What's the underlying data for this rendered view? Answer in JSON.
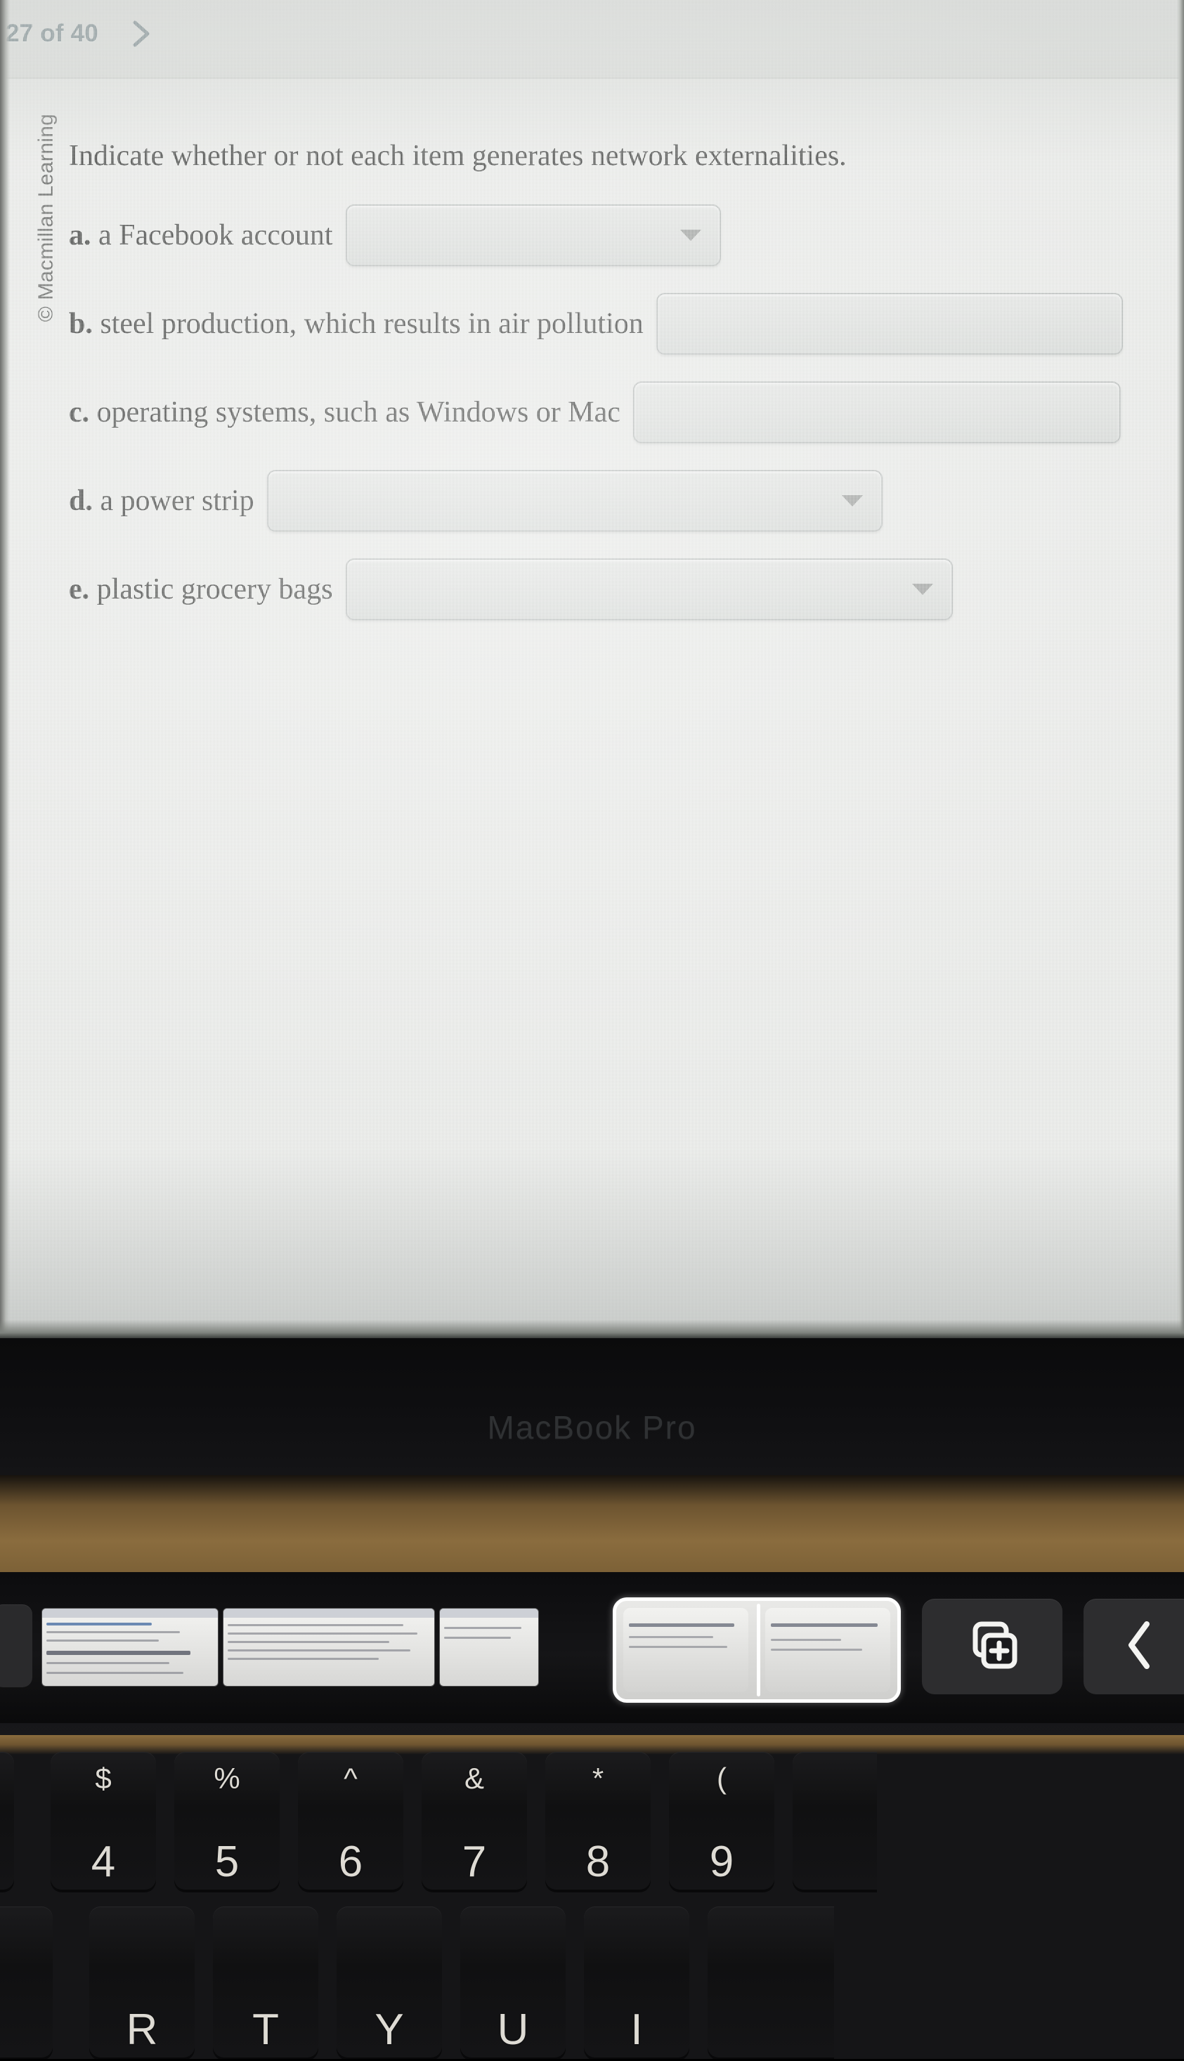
{
  "screen": {
    "toolbar": {
      "page_counter": "27 of 40",
      "next_icon": "chevron-right-icon"
    },
    "copyright": "© Macmillan Learning",
    "question": {
      "prompt": "Indicate whether or not each item generates network externalities.",
      "items": [
        {
          "letter": "a.",
          "text": "a Facebook account",
          "dropdown_value": "",
          "arrow": true
        },
        {
          "letter": "b.",
          "text": "steel production, which results in air pollution",
          "dropdown_value": "",
          "arrow": false
        },
        {
          "letter": "c.",
          "text": "operating systems, such as Windows or Mac",
          "dropdown_value": "",
          "arrow": false
        },
        {
          "letter": "d.",
          "text": "a power strip",
          "dropdown_value": "",
          "arrow": true
        },
        {
          "letter": "e.",
          "text": "plastic grocery bags",
          "dropdown_value": "",
          "arrow": true
        }
      ]
    }
  },
  "laptop": {
    "brand_text": "MacBook Pro",
    "touchbar": {
      "new_window_icon": "new-window-plus-icon",
      "back_icon": "chevron-left-icon"
    },
    "keyboard": {
      "row1": [
        {
          "top": "$",
          "bottom": "4"
        },
        {
          "top": "%",
          "bottom": "5"
        },
        {
          "top": "^",
          "bottom": "6"
        },
        {
          "top": "&",
          "bottom": "7"
        },
        {
          "top": "*",
          "bottom": "8"
        },
        {
          "top": "(",
          "bottom": "9"
        }
      ],
      "row2": [
        {
          "label": "R"
        },
        {
          "label": "T"
        },
        {
          "label": "Y"
        },
        {
          "label": "U"
        },
        {
          "label": "I"
        }
      ]
    }
  },
  "colors": {
    "accent_text": "#2d4852",
    "screen_bg": "#e9ebe8",
    "dropdown_bg": "#dcdfdc",
    "dropdown_border": "#b3b8b6",
    "key_face": "#141416",
    "desk": "#8a6c3e"
  }
}
